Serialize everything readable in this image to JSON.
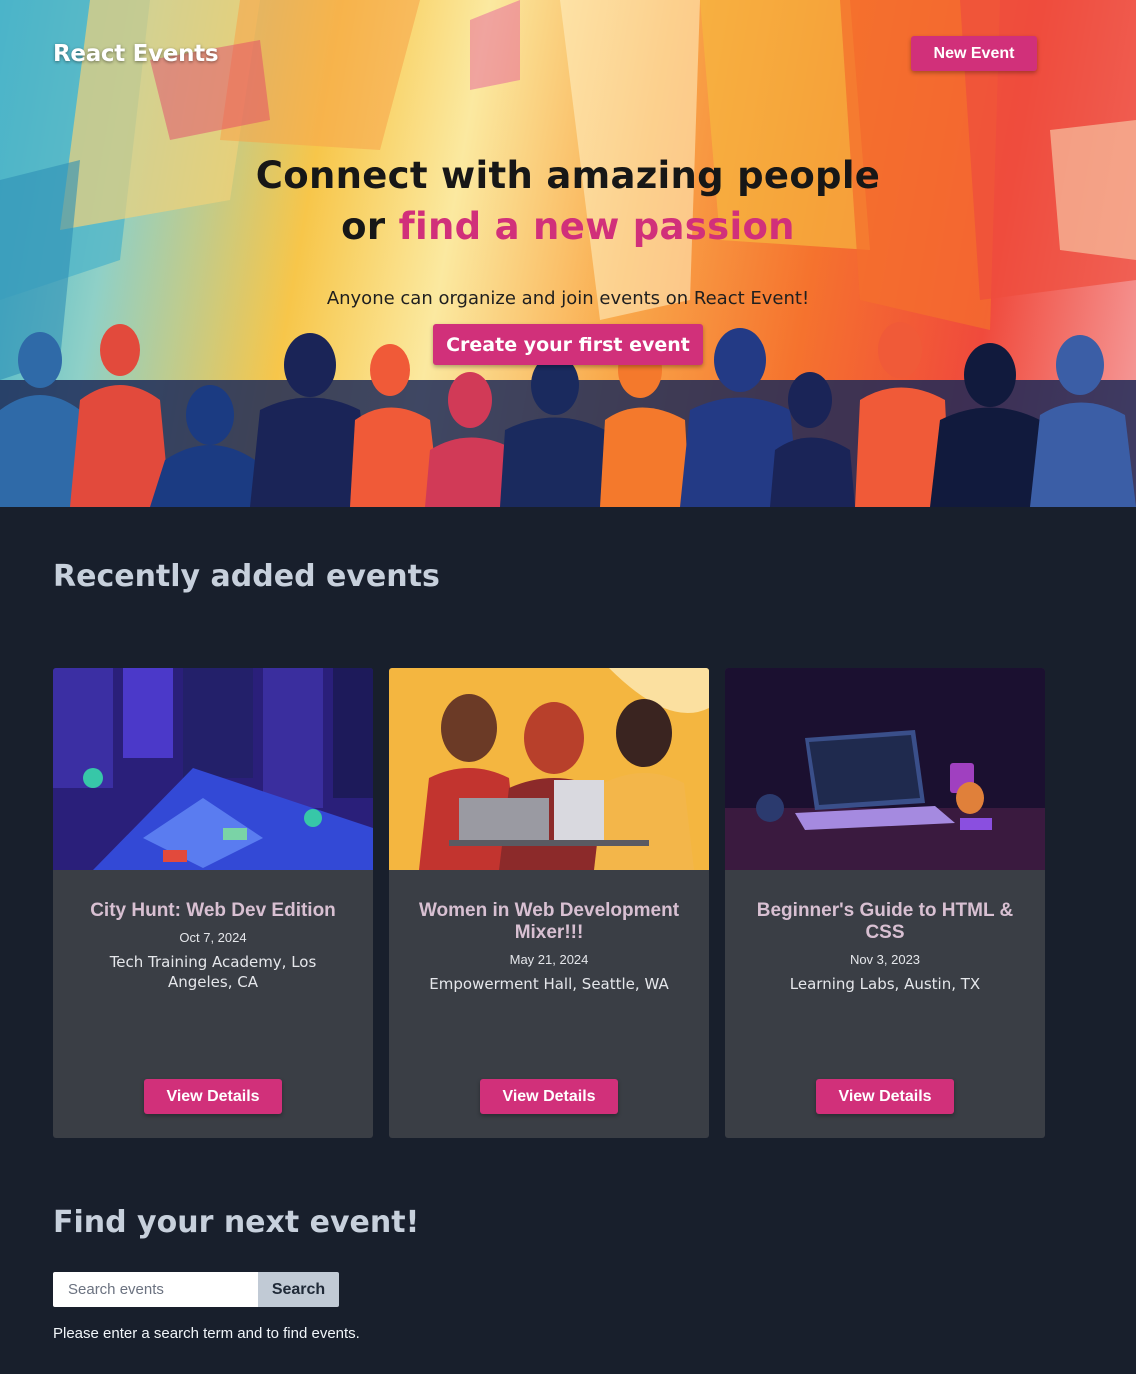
{
  "header": {
    "brand": "React Events",
    "new_event_label": "New Event"
  },
  "hero": {
    "title_line1": "Connect with amazing people",
    "title_or": "or ",
    "title_accent": "find a new passion",
    "subtitle": "Anyone can organize and join events on React Event!",
    "cta_label": "Create your first event"
  },
  "recent": {
    "title": "Recently added events",
    "events": [
      {
        "title": "City Hunt: Web Dev Edition",
        "date": "Oct 7, 2024",
        "location": "Tech Training Academy, Los Angeles, CA",
        "button": "View Details"
      },
      {
        "title": "Women in Web Development Mixer!!!",
        "date": "May 21, 2024",
        "location": "Empowerment Hall, Seattle, WA",
        "button": "View Details"
      },
      {
        "title": "Beginner's Guide to HTML & CSS",
        "date": "Nov 3, 2023",
        "location": "Learning Labs, Austin, TX",
        "button": "View Details"
      }
    ]
  },
  "find": {
    "title": "Find your next event!",
    "search_placeholder": "Search events",
    "search_value": "",
    "search_button": "Search",
    "hint": "Please enter a search term and to find events."
  },
  "colors": {
    "accent": "#d1307a",
    "page_bg": "#181f2c",
    "card_bg": "#3a3e45"
  }
}
